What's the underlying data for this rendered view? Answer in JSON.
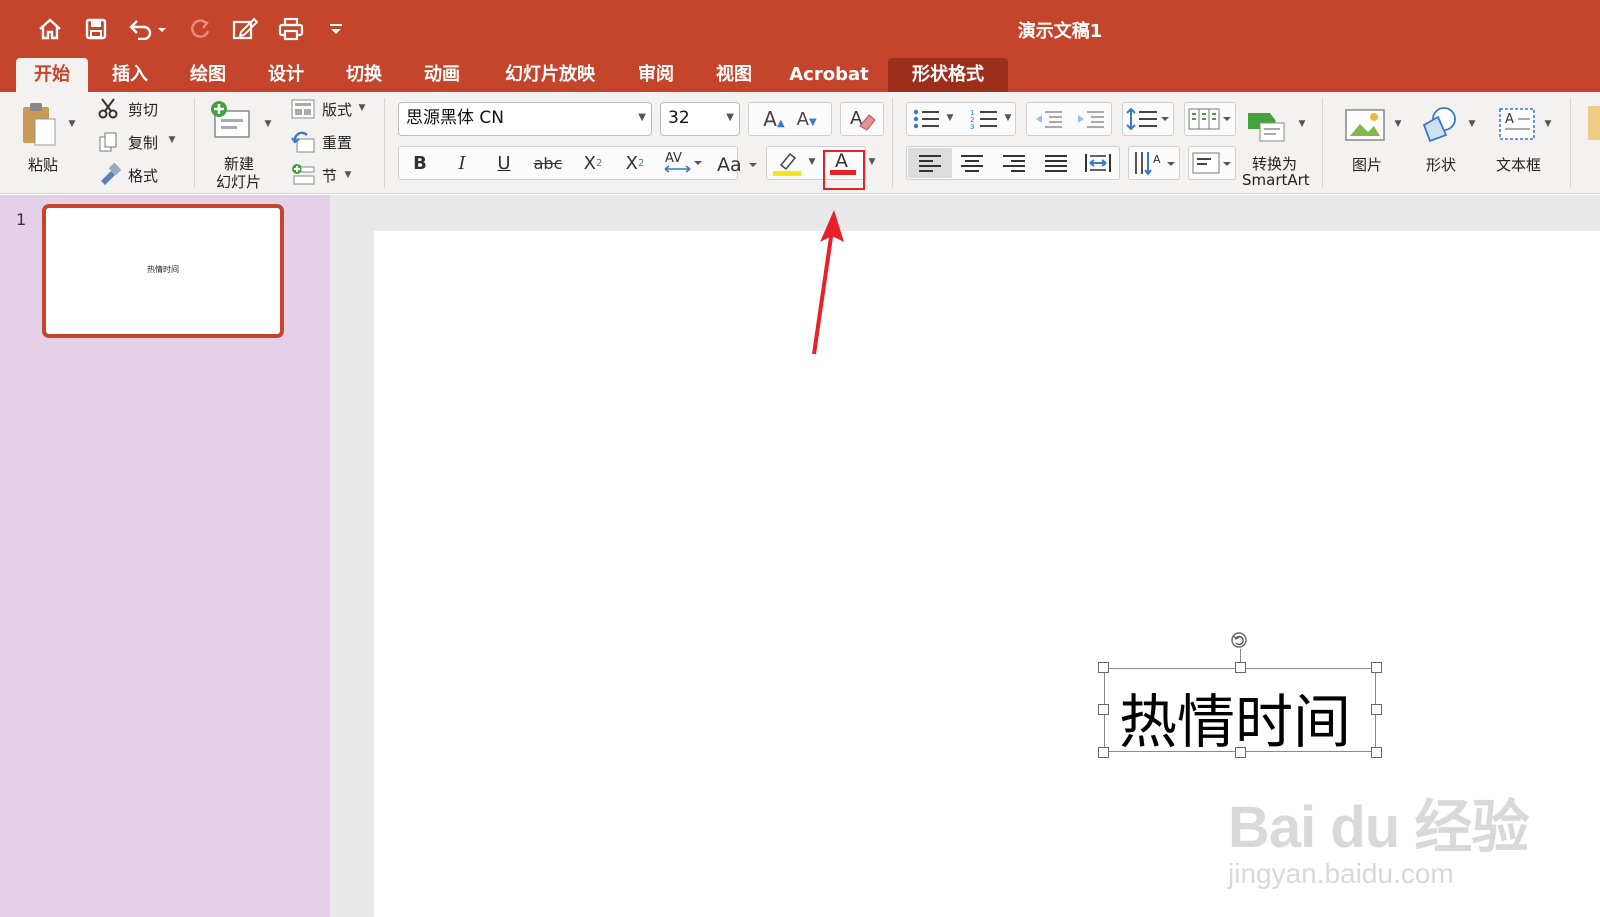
{
  "window": {
    "title": "演示文稿1"
  },
  "quick_access": [
    "home-icon",
    "save-icon",
    "undo-icon",
    "redo-icon",
    "edit-icon",
    "print-icon",
    "customize-icon"
  ],
  "tabs": [
    {
      "label": "开始",
      "active": true
    },
    {
      "label": "插入"
    },
    {
      "label": "绘图"
    },
    {
      "label": "设计"
    },
    {
      "label": "切换"
    },
    {
      "label": "动画"
    },
    {
      "label": "幻灯片放映"
    },
    {
      "label": "审阅"
    },
    {
      "label": "视图"
    },
    {
      "label": "Acrobat"
    },
    {
      "label": "形状格式",
      "contextual": true
    }
  ],
  "ribbon": {
    "clipboard": {
      "paste": "粘贴",
      "cut": "剪切",
      "copy": "复制",
      "format": "格式"
    },
    "slides": {
      "new_slide_line1": "新建",
      "new_slide_line2": "幻灯片",
      "layout": "版式",
      "reset": "重置",
      "section": "节"
    },
    "font": {
      "name": "思源黑体 CN",
      "size": "32"
    },
    "paragraph": {
      "convert_line1": "转换为",
      "convert_line2": "SmartArt"
    },
    "insert": {
      "picture": "图片",
      "shape": "形状",
      "textbox": "文本框"
    }
  },
  "slides_panel": {
    "slide_number": "1",
    "thumb_text": "热情时间"
  },
  "slide": {
    "text": "热情时间"
  },
  "watermark": {
    "brand": "Bai du 经验",
    "url": "jingyan.baidu.com"
  },
  "colors": {
    "accent": "#c4452b",
    "font_color_bar": "#e8202a",
    "highlight_bar": "#f5e61a"
  }
}
